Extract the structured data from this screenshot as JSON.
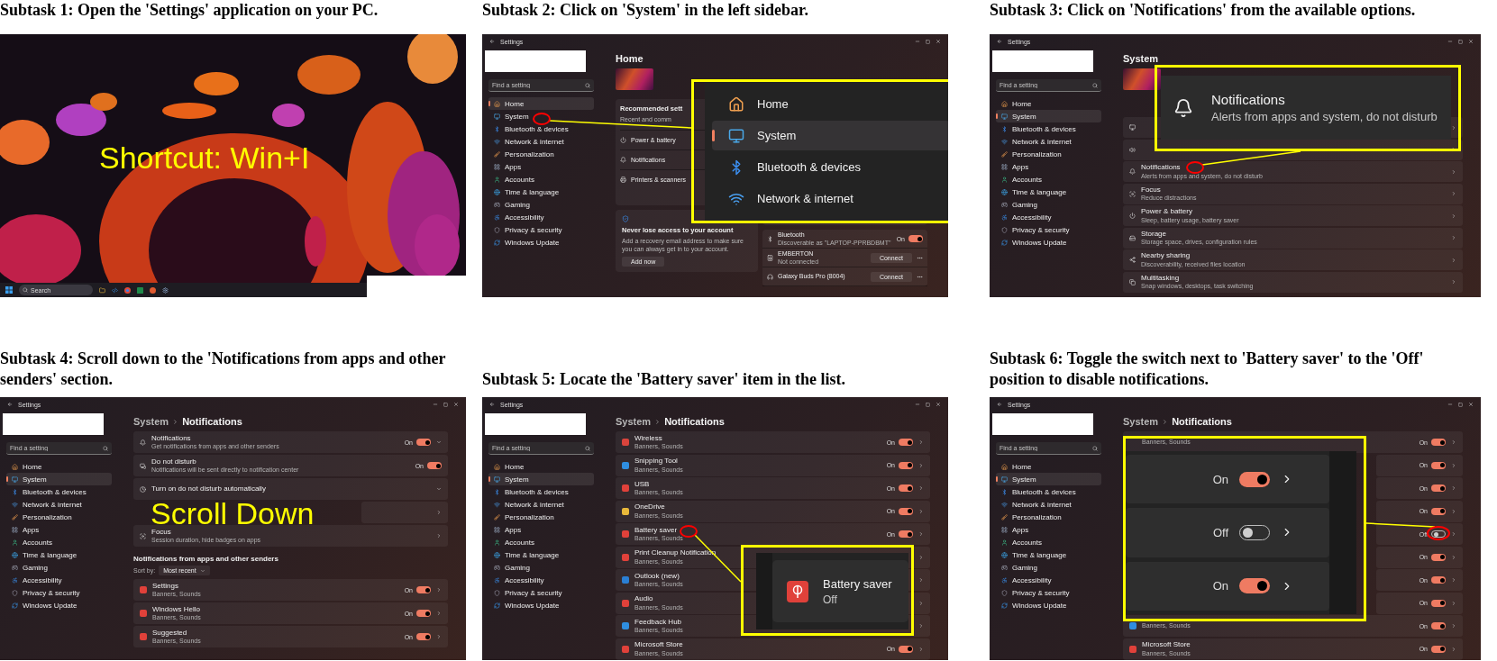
{
  "panels": [
    {
      "kind": "desktop",
      "caption": "Subtask 1: Open the 'Settings' application on your PC.",
      "overlay_text": "Shortcut: Win+I",
      "taskbar": {
        "search_placeholder": "Search"
      }
    },
    {
      "kind": "settings",
      "caption": "Subtask 2: Click on 'System' in the left sidebar.",
      "window_title": "Settings",
      "search_placeholder": "Find a setting",
      "nav": [
        {
          "label": "Home",
          "selected": true
        },
        {
          "label": "System",
          "selected": false
        },
        {
          "label": "Bluetooth & devices",
          "selected": false
        },
        {
          "label": "Network & internet",
          "selected": false
        },
        {
          "label": "Personalization",
          "selected": false
        },
        {
          "label": "Apps",
          "selected": false
        },
        {
          "label": "Accounts",
          "selected": false
        },
        {
          "label": "Time & language",
          "selected": false
        },
        {
          "label": "Gaming",
          "selected": false
        },
        {
          "label": "Accessibility",
          "selected": false
        },
        {
          "label": "Privacy & security",
          "selected": false
        },
        {
          "label": "Windows Update",
          "selected": false
        }
      ],
      "page": {
        "kind": "home",
        "title": "Home",
        "recommended": {
          "title": "Recommended sett",
          "subtitle": "Recent and comm",
          "items": [
            "Power & battery",
            "Notifications",
            "Printers & scanners"
          ]
        },
        "account": {
          "title": "Never lose access to your account",
          "text": "Add a recovery email address to make sure you can always get in to your account.",
          "button": "Add now"
        },
        "devices": [
          {
            "name": "Bluetooth",
            "status": "Discoverable as \"LAPTOP-PPRBDBMT\"",
            "toggle": {
              "label": "On",
              "on": true
            }
          },
          {
            "name": "EMBERTON",
            "status": "Not connected",
            "button": "Connect"
          },
          {
            "name": "Galaxy Buds Pro (8004)",
            "button": "Connect"
          }
        ]
      },
      "callout": {
        "kind": "nav",
        "items": [
          {
            "label": "Home",
            "selected": false
          },
          {
            "label": "System",
            "selected": true
          },
          {
            "label": "Bluetooth & devices",
            "selected": false
          },
          {
            "label": "Network & internet",
            "selected": false
          }
        ]
      }
    },
    {
      "kind": "settings",
      "caption": "Subtask 3: Click on 'Notifications' from the available options.",
      "window_title": "Settings",
      "search_placeholder": "Find a setting",
      "nav": [
        {
          "label": "Home",
          "selected": false
        },
        {
          "label": "System",
          "selected": true
        },
        {
          "label": "Bluetooth & devices",
          "selected": false
        },
        {
          "label": "Network & internet",
          "selected": false
        },
        {
          "label": "Personalization",
          "selected": false
        },
        {
          "label": "Apps",
          "selected": false
        },
        {
          "label": "Accounts",
          "selected": false
        },
        {
          "label": "Time & language",
          "selected": false
        },
        {
          "label": "Gaming",
          "selected": false
        },
        {
          "label": "Accessibility",
          "selected": false
        },
        {
          "label": "Privacy & security",
          "selected": false
        },
        {
          "label": "Windows Update",
          "selected": false
        }
      ],
      "page": {
        "kind": "system",
        "title": "System",
        "rows": [
          {},
          {},
          {
            "title": "Notifications",
            "subtitle": "Alerts from apps and system, do not disturb"
          },
          {
            "title": "Focus",
            "subtitle": "Reduce distractions"
          },
          {
            "title": "Power & battery",
            "subtitle": "Sleep, battery usage, battery saver"
          },
          {
            "title": "Storage",
            "subtitle": "Storage space, drives, configuration rules"
          },
          {
            "title": "Nearby sharing",
            "subtitle": "Discoverability, received files location"
          },
          {
            "title": "Multitasking",
            "subtitle": "Snap windows, desktops, task switching"
          }
        ]
      },
      "callout": {
        "kind": "row",
        "title": "Notifications",
        "subtitle": "Alerts from apps and system, do not disturb"
      }
    },
    {
      "kind": "settings",
      "caption": "Subtask 4: Scroll down to the 'Notifications from apps and other senders' section.",
      "window_title": "Settings",
      "search_placeholder": "Find a setting",
      "overlay_text": "Scroll Down",
      "nav": [
        {
          "label": "Home",
          "selected": false
        },
        {
          "label": "System",
          "selected": true
        },
        {
          "label": "Bluetooth & devices",
          "selected": false
        },
        {
          "label": "Network & internet",
          "selected": false
        },
        {
          "label": "Personalization",
          "selected": false
        },
        {
          "label": "Apps",
          "selected": false
        },
        {
          "label": "Accounts",
          "selected": false
        },
        {
          "label": "Time & language",
          "selected": false
        },
        {
          "label": "Gaming",
          "selected": false
        },
        {
          "label": "Accessibility",
          "selected": false
        },
        {
          "label": "Privacy & security",
          "selected": false
        },
        {
          "label": "Windows Update",
          "selected": false
        }
      ],
      "page": {
        "kind": "notifications",
        "breadcrumb": [
          "System",
          "Notifications"
        ],
        "rows": [
          {
            "kind": "expander",
            "title": "Notifications",
            "subtitle": "Get notifications from apps and other senders",
            "toggle": {
              "label": "On",
              "on": true
            }
          },
          {
            "kind": "switch",
            "title": "Do not disturb",
            "subtitle": "Notifications will be sent directly to notification center",
            "toggle": {
              "label": "On",
              "on": true
            }
          },
          {
            "kind": "expander",
            "title": "Turn on do not disturb automatically"
          },
          {
            "kind": "link"
          },
          {
            "kind": "link",
            "title": "Focus",
            "subtitle": "Session duration, hide badges on apps"
          }
        ],
        "section": {
          "heading": "Notifications from apps and other senders",
          "sort_label": "Sort by:",
          "sort_value": "Most recent"
        },
        "apps": [
          {
            "title": "Settings",
            "subtitle": "Banners, Sounds",
            "color": "#e0413a",
            "toggle": {
              "label": "On",
              "on": true
            }
          },
          {
            "title": "Windows Hello",
            "subtitle": "Banners, Sounds",
            "color": "#e0413a",
            "toggle": {
              "label": "On",
              "on": true
            }
          },
          {
            "title": "Suggested",
            "subtitle": "Banners, Sounds",
            "color": "#e0413a",
            "toggle": {
              "label": "On",
              "on": true
            }
          }
        ]
      }
    },
    {
      "kind": "settings",
      "caption": "Subtask 5: Locate the 'Battery saver' item in the list.",
      "window_title": "Settings",
      "search_placeholder": "Find a setting",
      "nav": [
        {
          "label": "Home",
          "selected": false
        },
        {
          "label": "System",
          "selected": true
        },
        {
          "label": "Bluetooth & devices",
          "selected": false
        },
        {
          "label": "Network & internet",
          "selected": false
        },
        {
          "label": "Personalization",
          "selected": false
        },
        {
          "label": "Apps",
          "selected": false
        },
        {
          "label": "Accounts",
          "selected": false
        },
        {
          "label": "Time & language",
          "selected": false
        },
        {
          "label": "Gaming",
          "selected": false
        },
        {
          "label": "Accessibility",
          "selected": false
        },
        {
          "label": "Privacy & security",
          "selected": false
        },
        {
          "label": "Windows Update",
          "selected": false
        }
      ],
      "page": {
        "kind": "notifications",
        "breadcrumb": [
          "System",
          "Notifications"
        ],
        "apps": [
          {
            "title": "Wireless",
            "subtitle": "Banners, Sounds",
            "color": "#d9443c",
            "toggle": {
              "label": "On",
              "on": true
            }
          },
          {
            "title": "Snipping Tool",
            "subtitle": "Banners, Sounds",
            "color": "#2f8ee0",
            "toggle": {
              "label": "On",
              "on": true
            }
          },
          {
            "title": "USB",
            "subtitle": "Banners, Sounds",
            "color": "#e0413a",
            "toggle": {
              "label": "On",
              "on": true
            }
          },
          {
            "title": "OneDrive",
            "subtitle": "Banners, Sounds",
            "color": "#e8b83a",
            "toggle": {
              "label": "On",
              "on": true
            }
          },
          {
            "title": "Battery saver",
            "subtitle": "Banners, Sounds",
            "color": "#e0413a",
            "toggle": {
              "label": "On",
              "on": true
            }
          },
          {
            "title": "Print Cleanup Notification",
            "subtitle": "Banners, Sounds",
            "color": "#e0413a"
          },
          {
            "title": "Outlook (new)",
            "subtitle": "Banners, Sounds",
            "color": "#2a7fd4"
          },
          {
            "title": "Audio",
            "subtitle": "Banners, Sounds",
            "color": "#e0413a"
          },
          {
            "title": "Feedback Hub",
            "subtitle": "Banners, Sounds",
            "color": "#2f8ee0"
          },
          {
            "title": "Microsoft Store",
            "subtitle": "Banners, Sounds",
            "color": "#e0413a",
            "toggle": {
              "label": "On",
              "on": true
            }
          }
        ]
      },
      "callout": {
        "kind": "app",
        "title": "Battery saver",
        "subtitle": "Off",
        "color": "#e0413a"
      }
    },
    {
      "kind": "settings",
      "caption": "Subtask 6: Toggle the switch next to 'Battery saver' to the 'Off' position to disable notifications.",
      "window_title": "Settings",
      "search_placeholder": "Find a setting",
      "nav": [
        {
          "label": "Home",
          "selected": false
        },
        {
          "label": "System",
          "selected": true
        },
        {
          "label": "Bluetooth & devices",
          "selected": false
        },
        {
          "label": "Network & internet",
          "selected": false
        },
        {
          "label": "Personalization",
          "selected": false
        },
        {
          "label": "Apps",
          "selected": false
        },
        {
          "label": "Accounts",
          "selected": false
        },
        {
          "label": "Time & language",
          "selected": false
        },
        {
          "label": "Gaming",
          "selected": false
        },
        {
          "label": "Accessibility",
          "selected": false
        },
        {
          "label": "Privacy & security",
          "selected": false
        },
        {
          "label": "Windows Update",
          "selected": false
        }
      ],
      "page": {
        "kind": "notifications",
        "breadcrumb": [
          "System",
          "Notifications"
        ],
        "apps": [
          {
            "subtitle": "Banners, Sounds",
            "toggle": {
              "label": "On",
              "on": true
            }
          },
          {
            "toggle": {
              "label": "On",
              "on": true
            }
          },
          {
            "toggle": {
              "label": "On",
              "on": true
            }
          },
          {
            "toggle": {
              "label": "On",
              "on": true
            }
          },
          {
            "toggle": {
              "label": "Off",
              "on": false
            }
          },
          {
            "toggle": {
              "label": "On",
              "on": true
            }
          },
          {
            "toggle": {
              "label": "On",
              "on": true
            }
          },
          {
            "toggle": {
              "label": "On",
              "on": true
            }
          },
          {
            "subtitle": "Banners, Sounds",
            "color": "#2f8ee0",
            "toggle": {
              "label": "On",
              "on": true
            }
          },
          {
            "title": "Microsoft Store",
            "subtitle": "Banners, Sounds",
            "color": "#e0413a",
            "toggle": {
              "label": "On",
              "on": true
            }
          }
        ]
      },
      "callout": {
        "kind": "toggles",
        "items": [
          {
            "label": "On",
            "on": true
          },
          {
            "label": "Off",
            "on": false
          },
          {
            "label": "On",
            "on": true
          }
        ]
      }
    }
  ]
}
